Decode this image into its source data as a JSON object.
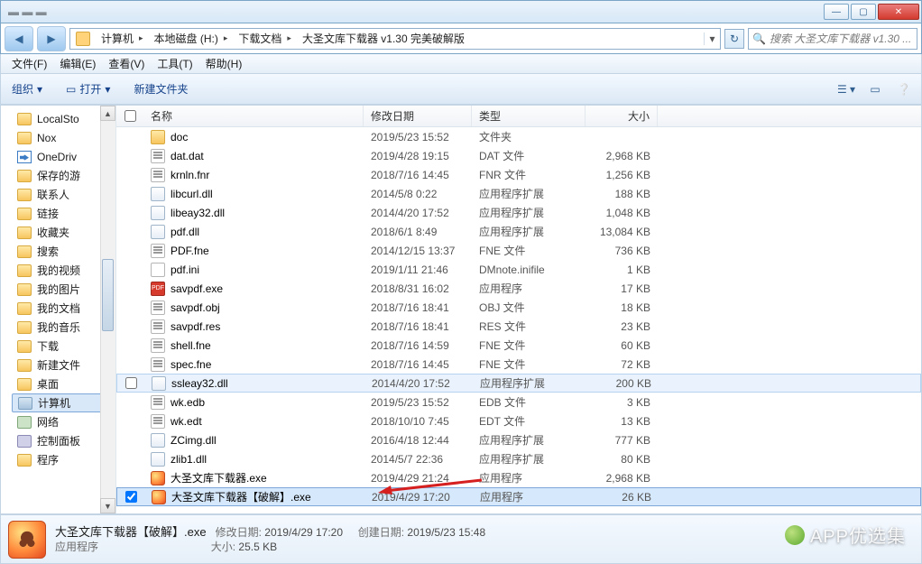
{
  "window": {
    "min": "—",
    "max": "▢",
    "close": "✕"
  },
  "breadcrumb": {
    "nodes": [
      "计算机",
      "本地磁盘 (H:)",
      "下载文档",
      "大圣文库下载器 v1.30 完美破解版"
    ]
  },
  "search": {
    "placeholder": "搜索 大圣文库下载器 v1.30 ..."
  },
  "menu": {
    "file": "文件(F)",
    "edit": "编辑(E)",
    "view": "查看(V)",
    "tools": "工具(T)",
    "help": "帮助(H)"
  },
  "toolbar": {
    "organize": "组织",
    "open": "打开",
    "newfolder": "新建文件夹"
  },
  "columns": {
    "name": "名称",
    "date": "修改日期",
    "type": "类型",
    "size": "大小"
  },
  "sidebar": [
    {
      "label": "LocalSto",
      "icon": "fold"
    },
    {
      "label": "Nox",
      "icon": "fold"
    },
    {
      "label": "OneDriv",
      "icon": "od"
    },
    {
      "label": "保存的游",
      "icon": "fold"
    },
    {
      "label": "联系人",
      "icon": "fold"
    },
    {
      "label": "链接",
      "icon": "fold"
    },
    {
      "label": "收藏夹",
      "icon": "fold"
    },
    {
      "label": "搜索",
      "icon": "fold"
    },
    {
      "label": "我的视频",
      "icon": "fold"
    },
    {
      "label": "我的图片",
      "icon": "fold"
    },
    {
      "label": "我的文档",
      "icon": "fold"
    },
    {
      "label": "我的音乐",
      "icon": "fold"
    },
    {
      "label": "下载",
      "icon": "fold"
    },
    {
      "label": "新建文件",
      "icon": "fold"
    },
    {
      "label": "桌面",
      "icon": "fold"
    },
    {
      "label": "计算机",
      "icon": "comp",
      "selected": true
    },
    {
      "label": "网络",
      "icon": "net"
    },
    {
      "label": "控制面板",
      "icon": "cp"
    },
    {
      "label": "程序",
      "icon": "fold"
    }
  ],
  "files": [
    {
      "name": "doc",
      "date": "2019/5/23 15:52",
      "type": "文件夹",
      "size": "",
      "icon": "fold"
    },
    {
      "name": "dat.dat",
      "date": "2019/4/28 19:15",
      "type": "DAT 文件",
      "size": "2,968 KB",
      "icon": "doc"
    },
    {
      "name": "krnln.fnr",
      "date": "2018/7/16 14:45",
      "type": "FNR 文件",
      "size": "1,256 KB",
      "icon": "doc"
    },
    {
      "name": "libcurl.dll",
      "date": "2014/5/8 0:22",
      "type": "应用程序扩展",
      "size": "188 KB",
      "icon": "dll"
    },
    {
      "name": "libeay32.dll",
      "date": "2014/4/20 17:52",
      "type": "应用程序扩展",
      "size": "1,048 KB",
      "icon": "dll"
    },
    {
      "name": "pdf.dll",
      "date": "2018/6/1 8:49",
      "type": "应用程序扩展",
      "size": "13,084 KB",
      "icon": "dll"
    },
    {
      "name": "PDF.fne",
      "date": "2014/12/15 13:37",
      "type": "FNE 文件",
      "size": "736 KB",
      "icon": "doc"
    },
    {
      "name": "pdf.ini",
      "date": "2019/1/11 21:46",
      "type": "DMnote.inifile",
      "size": "1 KB",
      "icon": "ini"
    },
    {
      "name": "savpdf.exe",
      "date": "2018/8/31 16:02",
      "type": "应用程序",
      "size": "17 KB",
      "icon": "pdf"
    },
    {
      "name": "savpdf.obj",
      "date": "2018/7/16 18:41",
      "type": "OBJ 文件",
      "size": "18 KB",
      "icon": "doc"
    },
    {
      "name": "savpdf.res",
      "date": "2018/7/16 18:41",
      "type": "RES 文件",
      "size": "23 KB",
      "icon": "doc"
    },
    {
      "name": "shell.fne",
      "date": "2018/7/16 14:59",
      "type": "FNE 文件",
      "size": "60 KB",
      "icon": "doc"
    },
    {
      "name": "spec.fne",
      "date": "2018/7/16 14:45",
      "type": "FNE 文件",
      "size": "72 KB",
      "icon": "doc"
    },
    {
      "name": "ssleay32.dll",
      "date": "2014/4/20 17:52",
      "type": "应用程序扩展",
      "size": "200 KB",
      "icon": "dll",
      "hover": true
    },
    {
      "name": "wk.edb",
      "date": "2019/5/23 15:52",
      "type": "EDB 文件",
      "size": "3 KB",
      "icon": "doc"
    },
    {
      "name": "wk.edt",
      "date": "2018/10/10 7:45",
      "type": "EDT 文件",
      "size": "13 KB",
      "icon": "doc"
    },
    {
      "name": "ZCimg.dll",
      "date": "2016/4/18 12:44",
      "type": "应用程序扩展",
      "size": "777 KB",
      "icon": "dll"
    },
    {
      "name": "zlib1.dll",
      "date": "2014/5/7 22:36",
      "type": "应用程序扩展",
      "size": "80 KB",
      "icon": "dll"
    },
    {
      "name": "大圣文库下载器.exe",
      "date": "2019/4/29 21:24",
      "type": "应用程序",
      "size": "2,968 KB",
      "icon": "app"
    },
    {
      "name": "大圣文库下载器【破解】.exe",
      "date": "2019/4/29 17:20",
      "type": "应用程序",
      "size": "26 KB",
      "icon": "app",
      "selected": true,
      "checked": true
    }
  ],
  "details": {
    "title": "大圣文库下载器【破解】.exe",
    "sub": "应用程序",
    "modLabel": "修改日期:",
    "modVal": "2019/4/29 17:20",
    "createLabel": "创建日期:",
    "createVal": "2019/5/23 15:48",
    "sizeLabel": "大小:",
    "sizeVal": "25.5 KB"
  },
  "watermark": "APP优选集"
}
